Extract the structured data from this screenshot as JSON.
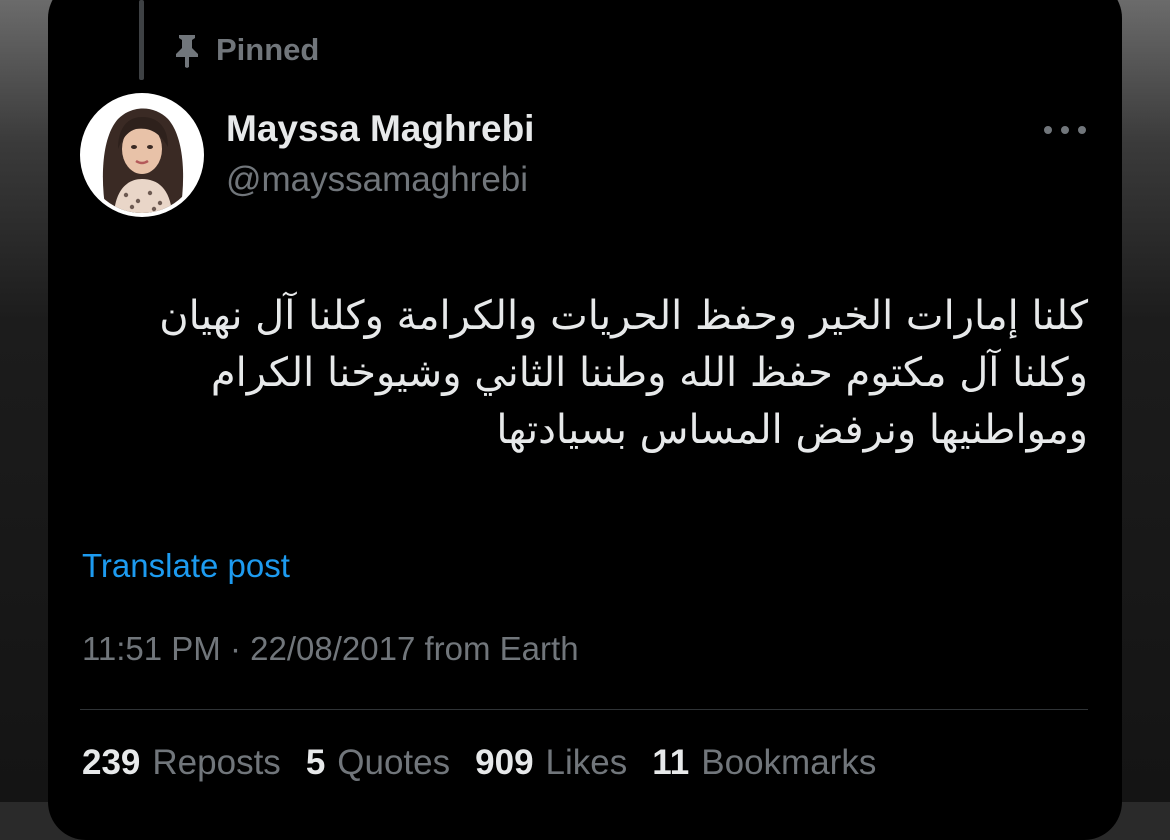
{
  "pinned": {
    "label": "Pinned",
    "icon": "pin-icon"
  },
  "author": {
    "display_name": "Mayssa Maghrebi",
    "handle": "@mayssamaghrebi",
    "avatar_icon": "profile-avatar"
  },
  "more_icon": "more-horizontal-icon",
  "tweet": {
    "lines": [
      "كلنا إمارات الخير وحفظ الحريات والكرامة وكلنا آل نهيان",
      "وكلنا آل مكتوم حفظ الله وطننا الثاني وشيوخنا الكرام",
      "ومواطنيها ونرفض المساس بسيادتها"
    ]
  },
  "translate_label": "Translate post",
  "meta": {
    "time": "11:51 PM",
    "separator": "·",
    "date": "22/08/2017",
    "source": "from Earth"
  },
  "stats": [
    {
      "count": "239",
      "label": "Reposts"
    },
    {
      "count": "5",
      "label": "Quotes"
    },
    {
      "count": "909",
      "label": "Likes"
    },
    {
      "count": "11",
      "label": "Bookmarks"
    }
  ],
  "colors": {
    "background": "#000000",
    "primary_text": "#e7e9ea",
    "secondary_text": "#71767b",
    "link": "#1d9bf0",
    "divider": "#2f3336"
  }
}
